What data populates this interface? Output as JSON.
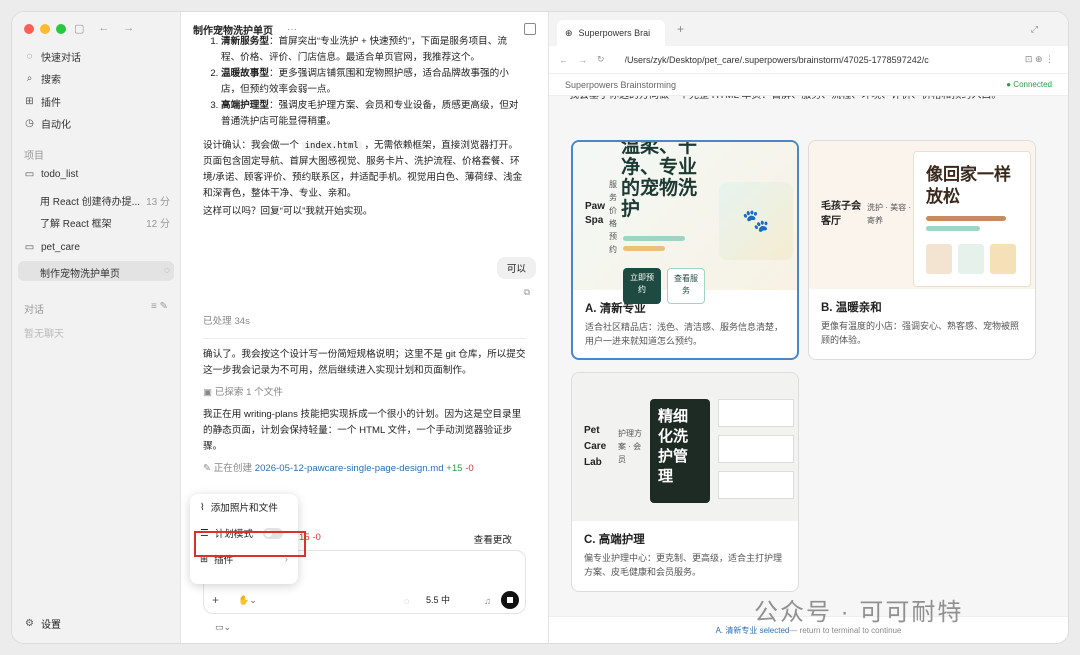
{
  "sidebar": {
    "nav": [
      "快速对话",
      "搜索",
      "插件",
      "自动化"
    ],
    "projects_label": "项目",
    "projects": [
      {
        "name": "todo_list",
        "items": [
          {
            "label": "用 React 创建待办提...",
            "time": "13 分"
          },
          {
            "label": "了解 React 框架",
            "time": "12 分"
          }
        ]
      },
      {
        "name": "pet_care",
        "items": [
          {
            "label": "制作宠物洗护单页",
            "time": ""
          }
        ]
      }
    ],
    "chats_label": "对话",
    "no_chats": "暂无聊天",
    "settings": "设置"
  },
  "chat": {
    "title": "制作宠物洗护单页",
    "list": [
      {
        "bold": "清新服务型",
        "text": "：首屏突出“专业洗护 + 快速预约”，下面是服务项目、流程、价格、评价、门店信息。最适合单页官网，我推荐这个。"
      },
      {
        "bold": "温暖故事型",
        "text": "：更多强调店铺氛围和宠物照护感，适合品牌故事强的小店，但预约效率会弱一点。"
      },
      {
        "bold": "高端护理型",
        "text": "：强调皮毛护理方案、会员和专业设备，质感更高级，但对普通洗护店可能显得稍重。"
      }
    ],
    "design_confirm_1": "设计确认：我会做一个 ",
    "design_code": "index.html",
    "design_confirm_2": " ，无需依赖框架，直接浏览器打开。页面包含固定导航、首屏大图感视觉、服务卡片、洗护流程、价格套餐、环境/承诺、顾客评价、预约联系区，并适配手机。视觉用白色、薄荷绿、浅金和深青色，整体干净、专业、亲和。",
    "question": "这样可以吗？回复“可以”我就开始实现。",
    "user_reply": "可以",
    "processed": "已处理 34s",
    "para2": "确认了。我会按这个设计写一份简短规格说明；这里不是 git 仓库，所以提交这一步我会记录为不可用，然后继续进入实现计划和页面制作。",
    "explored": "已探索 1 个文件",
    "para3": "我正在用 writing-plans 技能把实现拆成一个很小的计划。因为这是空目录里的静态页面，计划会保持轻量：一个 HTML 文件，一个手动浏览器验证步骤。",
    "creating_label": "正在创建",
    "creating_file": "2026-05-12-pawcare-single-page-design.md",
    "creating_add": "+15",
    "creating_del": "-0",
    "change_del": "15 -0",
    "view_changes": "查看更改",
    "menu": {
      "attach": "添加照片和文件",
      "plan_mode": "计划模式",
      "plugins": "插件"
    },
    "model": "5.5 中"
  },
  "browser": {
    "tab_title": "Superpowers Brai",
    "url": "/Users/zyk/Desktop/pet_care/.superpowers/brainstorm/47025-1778597242/c",
    "app_title": "Superpowers Brainstorming",
    "status": "Connected",
    "intro": "我会基于你选的方向做一个完整 HTML 单页：首屏、服务、流程、环境、评价、价格和预约入口。",
    "cards": [
      {
        "title": "A. 清新专业",
        "desc": "适合社区精品店：浅色、清洁感、服务信息清楚，用户一进来就知道怎么预约。",
        "brand": "Paw Spa",
        "side": "服务 价格 预约",
        "headline": "温柔、干净、专业的宠物洗护",
        "btn1": "立即预约",
        "btn2": "查看服务"
      },
      {
        "title": "B. 温暖亲和",
        "desc": "更像有温度的小店：强调安心、熟客感、宠物被照顾的体验。",
        "brand": "毛孩子会客厅",
        "side": "洗护 · 美容 · 寄养",
        "headline": "像回家一样放松"
      },
      {
        "title": "C. 高端护理",
        "desc": "偏专业护理中心：更克制、更高级，适合主打护理方案、皮毛健康和会员服务。",
        "brand": "Pet Care Lab",
        "side": "护理方案 · 会员",
        "headline": "精细化洗护管理"
      }
    ],
    "footer_selected": "A. 清新专业 selected",
    "footer_rest": " — return to terminal to continue"
  },
  "watermark": "公众号 · 可可耐特"
}
